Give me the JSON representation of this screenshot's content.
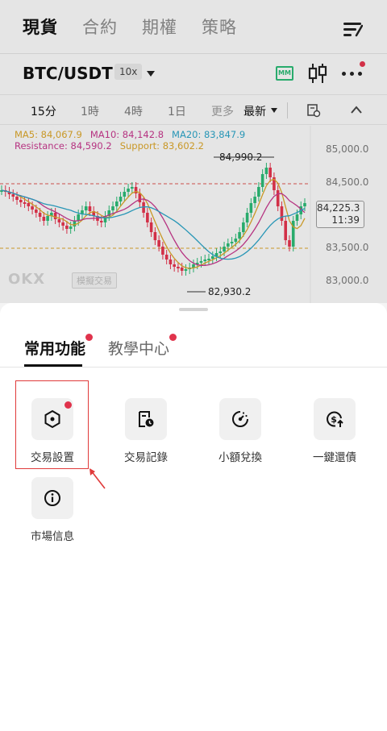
{
  "header": {
    "tabs": [
      "現貨",
      "合約",
      "期權",
      "策略"
    ],
    "active_tab": 0,
    "menu_icon": "list-menu-icon"
  },
  "pair_bar": {
    "pair": "BTC/USDT",
    "leverage": "10x",
    "icons": [
      "market-maker-icon",
      "candlestick-icon",
      "more-icon"
    ],
    "mm_label": "MM"
  },
  "timeframes": {
    "items": [
      "15分",
      "1時",
      "4時",
      "1日",
      "更多",
      "最新"
    ],
    "active": "15分"
  },
  "chart_info": {
    "ma5": "MA5: 84,067.9",
    "ma10": "MA10: 84,142.8",
    "ma20": "MA20: 83,847.9",
    "resistance": "Resistance: 84,590.2",
    "support": "Support: 83,602.2",
    "high_label": "84,990.2",
    "low_label": "82,930.2",
    "current_price": "84,225.3",
    "countdown": "11:39",
    "price_axis": [
      "85,000.0",
      "84,500.0",
      "83,500.0",
      "83,000.0"
    ],
    "logo": "OKX",
    "demo_badge": "模擬交易",
    "colors": {
      "up": "#2bb673",
      "down": "#e0334c",
      "ma5": "#d6a22a",
      "ma10": "#c2378a",
      "ma20": "#2ba0c2"
    }
  },
  "sheet": {
    "tabs": [
      "常用功能",
      "教學中心"
    ],
    "active_tab": 0,
    "features": [
      {
        "label": "交易設置",
        "icon": "hexagon-settings-icon",
        "badge": true
      },
      {
        "label": "交易記錄",
        "icon": "trade-record-icon",
        "badge": false
      },
      {
        "label": "小額兌換",
        "icon": "small-exchange-icon",
        "badge": false
      },
      {
        "label": "一鍵還債",
        "icon": "repay-dollar-icon",
        "badge": false
      },
      {
        "label": "市場信息",
        "icon": "info-icon",
        "badge": false
      }
    ]
  }
}
